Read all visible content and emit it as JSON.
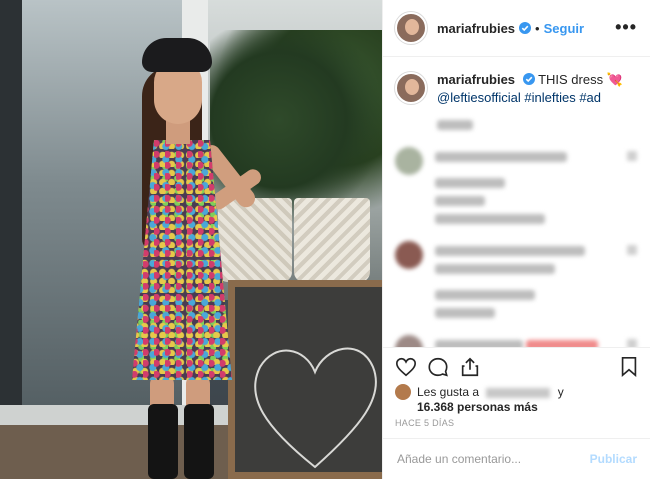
{
  "post": {
    "username": "mariafrubies",
    "follow_label": "Seguir",
    "more_label": "•••",
    "separator": "•"
  },
  "caption": {
    "username": "mariafrubies",
    "text": "THIS dress",
    "emoji": "💘",
    "mention": "@leftiesofficial",
    "hashtags": "#inlefties #ad"
  },
  "likes": {
    "prefix": "Les gusta a",
    "conjunction": "y",
    "count_text": "16.368 personas más"
  },
  "timestamp": "HACE 5 DÍAS",
  "comment_box": {
    "placeholder": "Añade un comentario...",
    "publish_label": "Publicar"
  },
  "colors": {
    "accent": "#3897f0",
    "publish_disabled": "#b3dbff",
    "tag": "#003569",
    "verified": "#3897f0"
  },
  "icons": [
    "verified-badge-icon",
    "heart-icon",
    "comment-icon",
    "share-icon",
    "bookmark-icon",
    "more-options-icon"
  ]
}
